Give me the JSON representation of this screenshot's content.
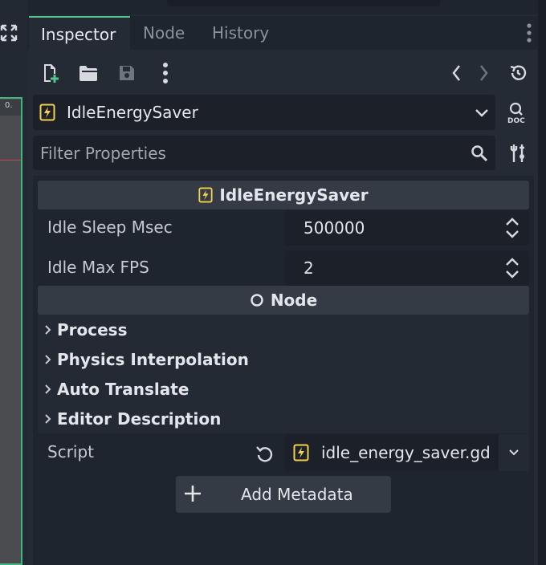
{
  "tabs": [
    {
      "label": "Inspector",
      "active": true
    },
    {
      "label": "Node",
      "active": false
    },
    {
      "label": "History",
      "active": false
    }
  ],
  "viewport": {
    "ruler_tick": "0."
  },
  "object_selector": {
    "name": "IdleEnergySaver"
  },
  "filter": {
    "placeholder": "Filter Properties"
  },
  "sections": {
    "script_class": {
      "title": "IdleEnergySaver"
    },
    "node": {
      "title": "Node"
    }
  },
  "properties": [
    {
      "label": "Idle Sleep Msec",
      "value": "500000"
    },
    {
      "label": "Idle Max FPS",
      "value": "2"
    }
  ],
  "groups": [
    {
      "label": "Process"
    },
    {
      "label": "Physics Interpolation"
    },
    {
      "label": "Auto Translate"
    },
    {
      "label": "Editor Description"
    }
  ],
  "script": {
    "label": "Script",
    "value": "idle_energy_saver.gd"
  },
  "add_metadata": {
    "label": "Add Metadata"
  },
  "icons": {
    "new": "new-resource-icon",
    "open": "open-folder-icon",
    "save": "save-icon",
    "more": "more-vertical-icon",
    "back": "chevron-left-icon",
    "forward": "chevron-right-icon",
    "history": "history-icon",
    "doc": "doc-icon",
    "search": "search-icon",
    "tools": "tools-icon"
  },
  "colors": {
    "accent": "#56c28c",
    "script_icon": "#f5d04a"
  }
}
